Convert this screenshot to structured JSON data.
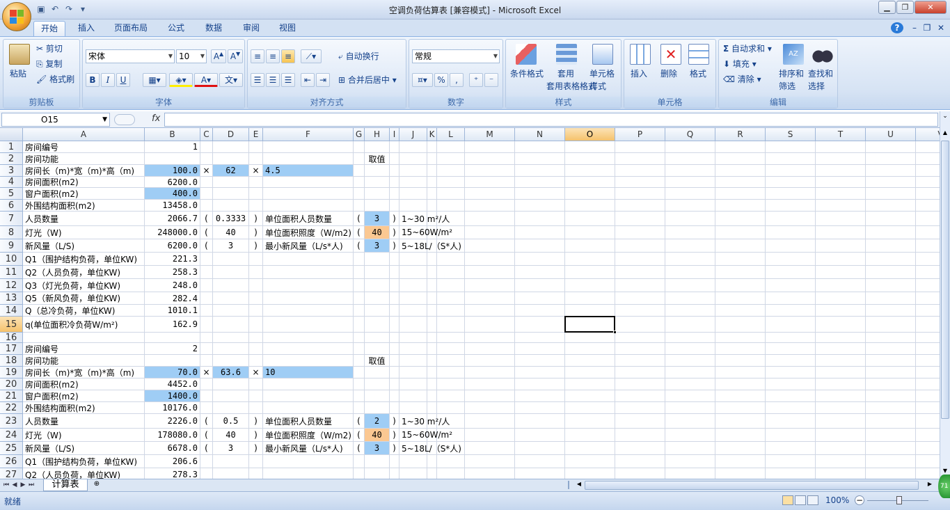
{
  "window": {
    "title": "空调负荷估算表  [兼容模式] - Microsoft Excel"
  },
  "tabs": [
    "开始",
    "插入",
    "页面布局",
    "公式",
    "数据",
    "审阅",
    "视图"
  ],
  "ribbon": {
    "clipboard": {
      "label": "剪贴板",
      "paste": "粘贴",
      "cut": "剪切",
      "copy": "复制",
      "format_painter": "格式刷"
    },
    "font": {
      "label": "字体",
      "font_name": "宋体",
      "font_size": "10",
      "bold": "B",
      "italic": "I",
      "underline": "U"
    },
    "alignment": {
      "label": "对齐方式",
      "wrap": "自动换行",
      "merge": "合并后居中"
    },
    "number": {
      "label": "数字",
      "format": "常规",
      "percent": "%",
      "comma": ","
    },
    "styles": {
      "label": "样式",
      "conditional": "条件格式",
      "table_format": "套用表格格式",
      "cell_styles": "单元格样式"
    },
    "cells": {
      "label": "单元格",
      "insert": "插入",
      "delete": "删除",
      "format": "格式"
    },
    "editing": {
      "label": "编辑",
      "autosum": "自动求和",
      "fill": "填充",
      "clear": "清除",
      "sort_filter": "排序和筛选",
      "find_select": "查找和选择"
    }
  },
  "formula_bar": {
    "name_box": "O15",
    "fx": "fx",
    "content": ""
  },
  "columns": [
    "A",
    "B",
    "C",
    "D",
    "E",
    "F",
    "G",
    "H",
    "I",
    "J",
    "K",
    "L",
    "M",
    "N",
    "O",
    "P",
    "Q",
    "R",
    "S",
    "T",
    "U",
    "V"
  ],
  "rows": [
    "1",
    "2",
    "3",
    "4",
    "5",
    "6",
    "7",
    "8",
    "9",
    "10",
    "11",
    "12",
    "13",
    "14",
    "15",
    "16",
    "17",
    "18",
    "19",
    "20",
    "21",
    "22",
    "23",
    "24",
    "25",
    "26",
    "27"
  ],
  "selected_cell": {
    "column": "O",
    "row": "15"
  },
  "cells": {
    "A1": "房间编号",
    "B1": "1",
    "A2": "房间功能",
    "H2": "取值",
    "A3": "房间长（m)*宽（m)*高（m)",
    "B3": "100.0",
    "C3": "×",
    "D3": "62",
    "E3": "×",
    "F3": "4.5",
    "A4": "房间面积(m2)",
    "B4": "6200.0",
    "A5": "窗户面积(m2)",
    "B5": "400.0",
    "A6": "外围结构面积(m2)",
    "B6": "13458.0",
    "A7": "人员数量",
    "B7": "2066.7",
    "C7": "(",
    "D7": "0.3333",
    "E7": ")",
    "F7": "单位面积人员数量",
    "G7": "(",
    "H7": "3",
    "I7": ")",
    "J7": "1~30 m²/人",
    "A8": "灯光（W)",
    "B8": "248000.0",
    "C8": "(",
    "D8": "40",
    "E8": ")",
    "F8": "单位面积照度（W/m2)",
    "G8": "(",
    "H8": "40",
    "I8": ")",
    "J8": "15~60W/m²",
    "A9": "新风量（L/S)",
    "B9": "6200.0",
    "C9": "(",
    "D9": "3",
    "E9": ")",
    "F9": "最小新风量（L/s*人)",
    "G9": "(",
    "H9": "3",
    "I9": ")",
    "J9": "5~18L/（S*人)",
    "A10": "Q1（围护结构负荷，单位KW)",
    "B10": "221.3",
    "A11": "Q2（人员负荷，单位KW)",
    "B11": "258.3",
    "A12": "Q3（灯光负荷，单位KW)",
    "B12": "248.0",
    "A13": "Q5（新风负荷，单位KW)",
    "B13": "282.4",
    "A14": "Q（总冷负荷，单位KW)",
    "B14": "1010.1",
    "A15": "q(单位面积冷负荷W/m²)",
    "B15": "162.9",
    "A17": "房间编号",
    "B17": "2",
    "A18": "房间功能",
    "H18": "取值",
    "A19": "房间长（m)*宽（m)*高（m)",
    "B19": "70.0",
    "C19": "×",
    "D19": "63.6",
    "E19": "×",
    "F19": "10",
    "A20": "房间面积(m2)",
    "B20": "4452.0",
    "A21": "窗户面积(m2)",
    "B21": "1400.0",
    "A22": "外围结构面积(m2)",
    "B22": "10176.0",
    "A23": "人员数量",
    "B23": "2226.0",
    "C23": "(",
    "D23": "0.5",
    "E23": ")",
    "F23": "单位面积人员数量",
    "G23": "(",
    "H23": "2",
    "I23": ")",
    "J23": "1~30 m²/人",
    "A24": "灯光（W)",
    "B24": "178080.0",
    "C24": "(",
    "D24": "40",
    "E24": ")",
    "F24": "单位面积照度（W/m2)",
    "G24": "(",
    "H24": "40",
    "I24": ")",
    "J24": "15~60W/m²",
    "A25": "新风量（L/S)",
    "B25": "6678.0",
    "C25": "(",
    "D25": "3",
    "E25": ")",
    "F25": "最小新风量（L/s*人)",
    "G25": "(",
    "H25": "3",
    "I25": ")",
    "J25": "5~18L/（S*人)",
    "A26": "Q1（围护结构负荷，单位KW)",
    "B26": "206.6",
    "A27": "Q2（人员负荷，单位KW)",
    "B27": "278.3"
  },
  "fills": {
    "blue": [
      "B3",
      "D3",
      "F3",
      "B5",
      "H7",
      "H9",
      "B19",
      "D19",
      "F19",
      "B21",
      "H23",
      "H25"
    ],
    "orange": [
      "H8",
      "H24"
    ]
  },
  "sheet_tabs": [
    "计算表"
  ],
  "status": {
    "ready": "就绪",
    "zoom": "100%"
  },
  "colors": {
    "cell_blue": "#9fcdf5",
    "cell_orange": "#fbc892",
    "ribbon_blue": "#15428b"
  }
}
